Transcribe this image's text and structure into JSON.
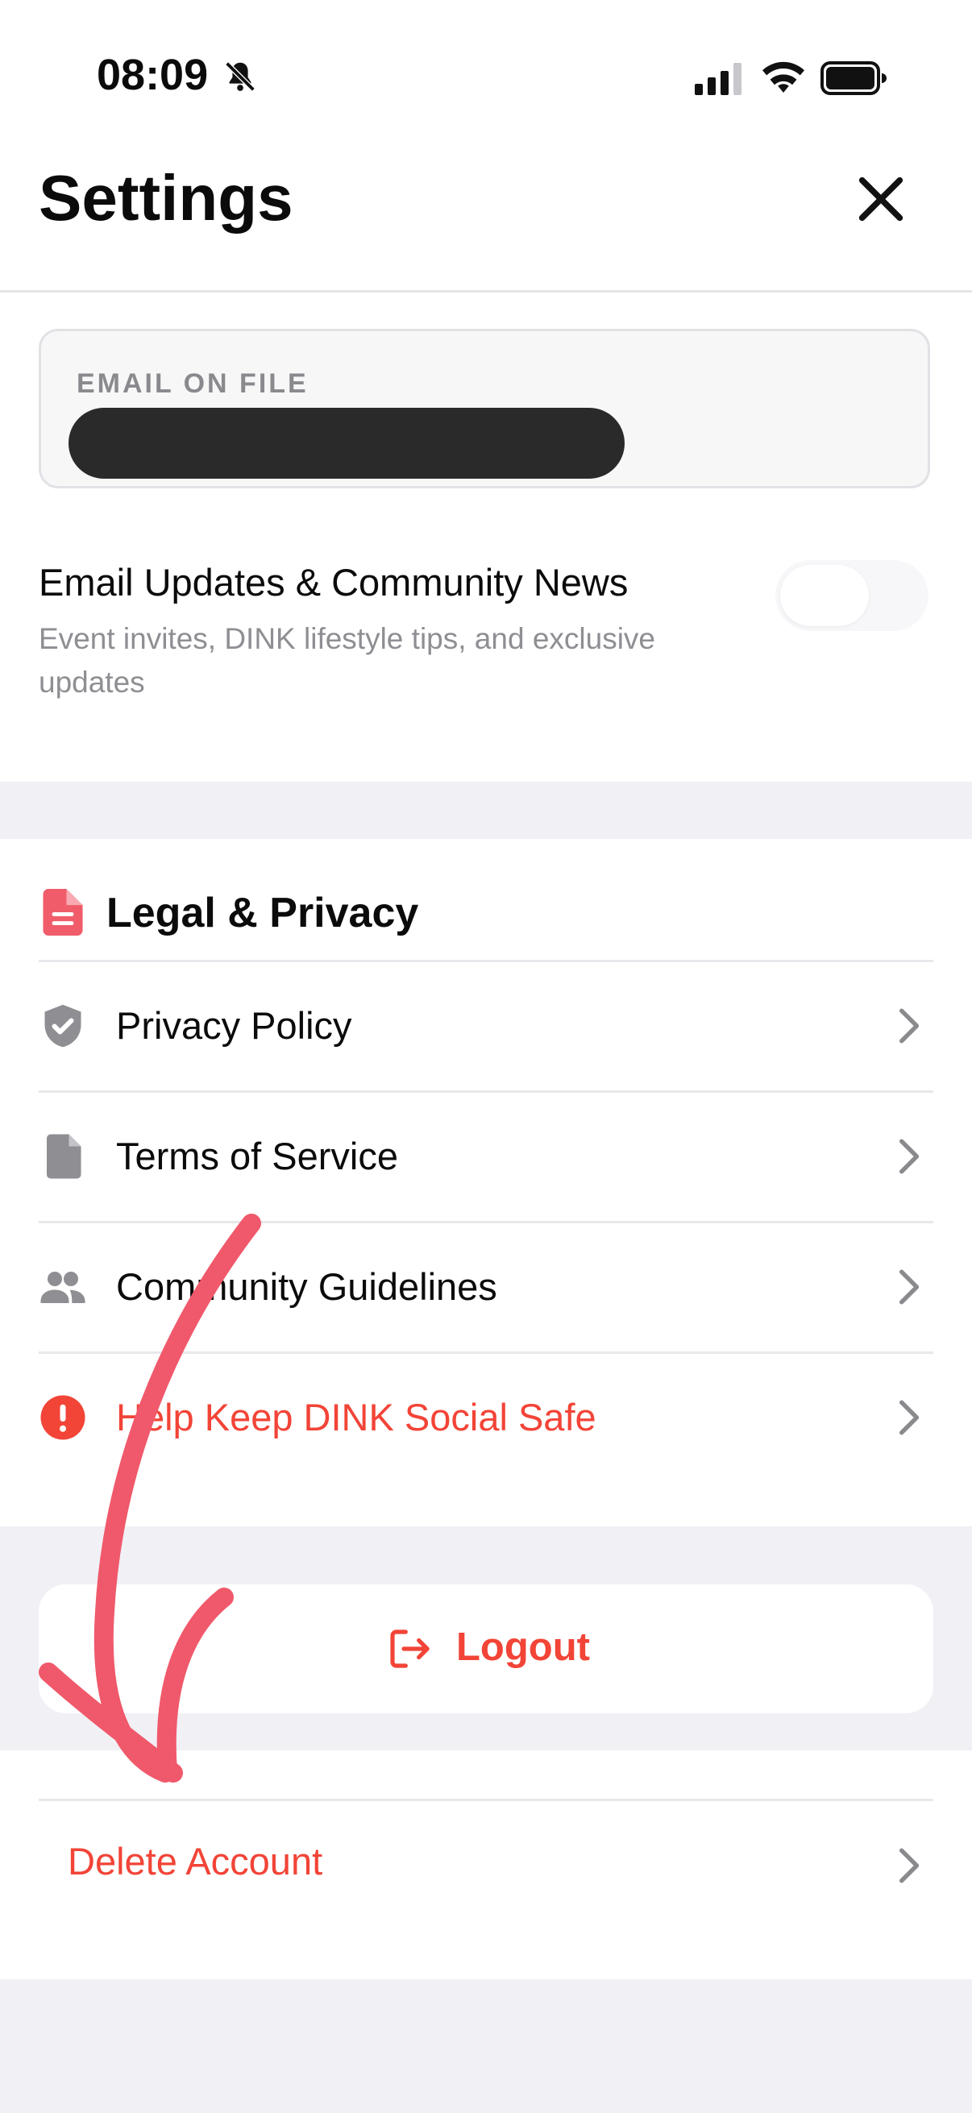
{
  "status_bar": {
    "time": "08:09"
  },
  "header": {
    "title": "Settings"
  },
  "email": {
    "label": "EMAIL ON FILE"
  },
  "newsletter": {
    "title": "Email Updates & Community News",
    "subtitle": "Event invites, DINK lifestyle tips, and exclusive updates",
    "enabled": false
  },
  "legal": {
    "title": "Legal & Privacy",
    "items": [
      {
        "label": "Privacy Policy",
        "icon": "shield-check-icon"
      },
      {
        "label": "Terms of Service",
        "icon": "document-icon"
      },
      {
        "label": "Community Guidelines",
        "icon": "people-icon"
      },
      {
        "label": "Help Keep DINK Social Safe",
        "icon": "alert-circle-icon"
      }
    ]
  },
  "logout": {
    "label": "Logout"
  },
  "delete_account": {
    "label": "Delete Account"
  },
  "colors": {
    "accent_red": "#f24437",
    "annotation_pink": "#f0596b",
    "icon_gray": "#8e8e93"
  }
}
